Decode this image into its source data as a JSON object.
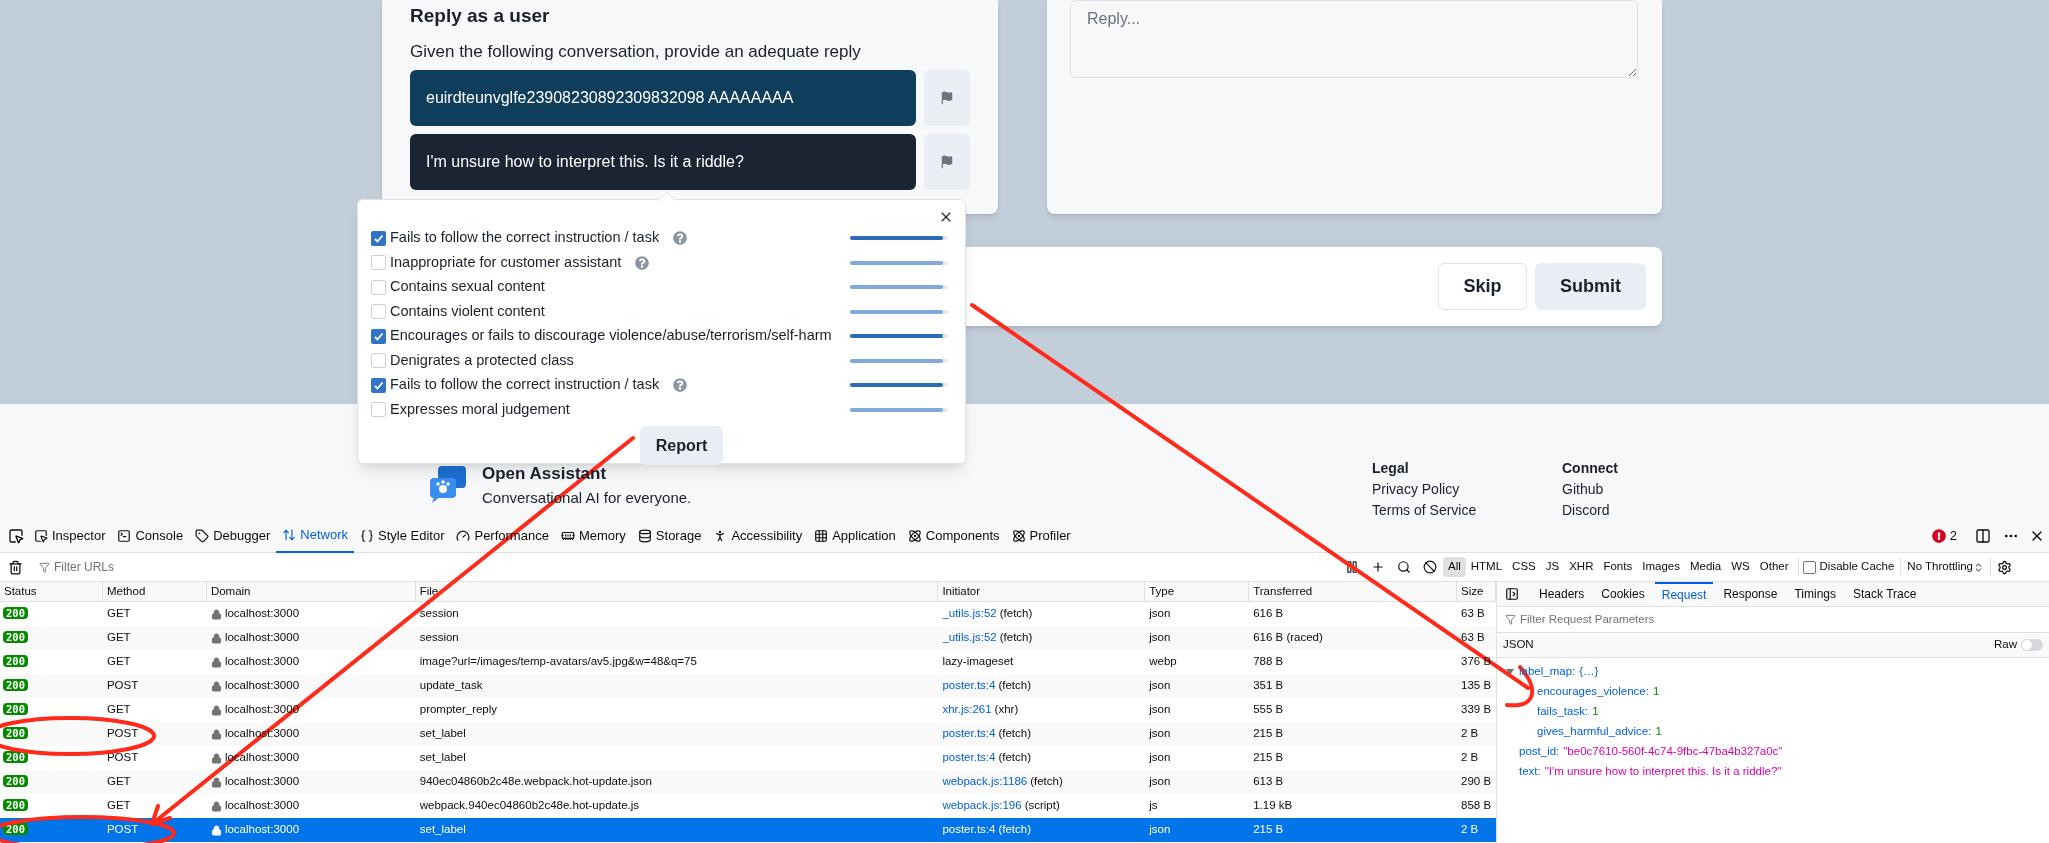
{
  "conversation_card": {
    "title": "Reply as a user",
    "instruction": "Given the following conversation, provide an adequate reply",
    "messages": [
      {
        "text": "euirdteunvglfe23908230892309832098 AAAAAAAA",
        "kind": "user"
      },
      {
        "text": "I'm unsure how to interpret this. Is it a riddle?",
        "kind": "assistant"
      }
    ]
  },
  "reply_card": {
    "placeholder": "Reply..."
  },
  "action_bar": {
    "buttons": [
      {
        "label": "Skip",
        "kind": "outline"
      },
      {
        "label": "Submit",
        "kind": "solid"
      }
    ]
  },
  "report_popup": {
    "labels": [
      {
        "text": "Fails to follow the correct instruction / task",
        "checked": true,
        "help": true,
        "level": 0.95
      },
      {
        "text": "Inappropriate for customer assistant",
        "checked": false,
        "help": true,
        "level": 0.95
      },
      {
        "text": "Contains sexual content",
        "checked": false,
        "help": false,
        "level": 0.95
      },
      {
        "text": "Contains violent content",
        "checked": false,
        "help": false,
        "level": 0.95
      },
      {
        "text": "Encourages or fails to discourage violence/abuse/terrorism/self-harm",
        "checked": true,
        "help": false,
        "level": 0.95
      },
      {
        "text": "Denigrates a protected class",
        "checked": false,
        "help": false,
        "level": 0.95
      },
      {
        "text": "Fails to follow the correct instruction / task",
        "checked": true,
        "help": true,
        "level": 0.95
      },
      {
        "text": "Expresses moral judgement",
        "checked": false,
        "help": false,
        "level": 0.95
      }
    ],
    "button": "Report"
  },
  "footer": {
    "brand": "Open Assistant",
    "tagline": "Conversational AI for everyone.",
    "columns": [
      {
        "heading": "Legal",
        "links": [
          "Privacy Policy",
          "Terms of Service"
        ]
      },
      {
        "heading": "Connect",
        "links": [
          "Github",
          "Discord"
        ]
      }
    ]
  },
  "devtools": {
    "tabs": [
      {
        "label": "Inspector",
        "selected": false
      },
      {
        "label": "Console",
        "selected": false
      },
      {
        "label": "Debugger",
        "selected": false
      },
      {
        "label": "Network",
        "selected": true
      },
      {
        "label": "Style Editor",
        "selected": false
      },
      {
        "label": "Performance",
        "selected": false
      },
      {
        "label": "Memory",
        "selected": false
      },
      {
        "label": "Storage",
        "selected": false
      },
      {
        "label": "Accessibility",
        "selected": false
      },
      {
        "label": "Application",
        "selected": false
      },
      {
        "label": "Components",
        "selected": false
      },
      {
        "label": "Profiler",
        "selected": false
      }
    ],
    "error_count": "2",
    "filter_placeholder": "Filter URLs",
    "type_filters": [
      {
        "label": "All",
        "selected": true
      },
      {
        "label": "HTML",
        "selected": false
      },
      {
        "label": "CSS",
        "selected": false
      },
      {
        "label": "JS",
        "selected": false
      },
      {
        "label": "XHR",
        "selected": false
      },
      {
        "label": "Fonts",
        "selected": false
      },
      {
        "label": "Images",
        "selected": false
      },
      {
        "label": "Media",
        "selected": false
      },
      {
        "label": "WS",
        "selected": false
      },
      {
        "label": "Other",
        "selected": false
      }
    ],
    "disable_cache": {
      "label": "Disable Cache",
      "checked": false
    },
    "throttling": "No Throttling",
    "columns": [
      "Status",
      "Method",
      "Domain",
      "File",
      "Initiator",
      "Type",
      "Transferred",
      "Size"
    ],
    "rows": [
      {
        "status": "200",
        "method": "GET",
        "domain": "localhost:3000",
        "file": "session",
        "initiator": "_utils.js:52",
        "initiator_note": "(fetch)",
        "type": "json",
        "transferred": "616 B",
        "size": "63 B",
        "selected": false
      },
      {
        "status": "200",
        "method": "GET",
        "domain": "localhost:3000",
        "file": "session",
        "initiator": "_utils.js:52",
        "initiator_note": "(fetch)",
        "type": "json",
        "transferred": "616 B (raced)",
        "size": "63 B",
        "selected": false
      },
      {
        "status": "200",
        "method": "GET",
        "domain": "localhost:3000",
        "file": "image?url=/images/temp-avatars/av5.jpg&w=48&q=75",
        "initiator": "lazy-imageset",
        "type": "webp",
        "transferred": "788 B",
        "size": "376 B",
        "selected": false
      },
      {
        "status": "200",
        "method": "POST",
        "domain": "localhost:3000",
        "file": "update_task",
        "initiator": "poster.ts:4",
        "initiator_note": "(fetch)",
        "type": "json",
        "transferred": "351 B",
        "size": "135 B",
        "selected": false
      },
      {
        "status": "200",
        "method": "GET",
        "domain": "localhost:3000",
        "file": "prompter_reply",
        "initiator": "xhr.js:261",
        "initiator_note": "(xhr)",
        "type": "json",
        "transferred": "555 B",
        "size": "339 B",
        "selected": false
      },
      {
        "status": "200",
        "method": "POST",
        "domain": "localhost:3000",
        "file": "set_label",
        "initiator": "poster.ts:4",
        "initiator_note": "(fetch)",
        "type": "json",
        "transferred": "215 B",
        "size": "2 B",
        "selected": false
      },
      {
        "status": "200",
        "method": "POST",
        "domain": "localhost:3000",
        "file": "set_label",
        "initiator": "poster.ts:4",
        "initiator_note": "(fetch)",
        "type": "json",
        "transferred": "215 B",
        "size": "2 B",
        "selected": false
      },
      {
        "status": "200",
        "method": "GET",
        "domain": "localhost:3000",
        "file": "940ec04860b2c48e.webpack.hot-update.json",
        "initiator": "webpack.js:1186",
        "initiator_note": "(fetch)",
        "type": "json",
        "transferred": "613 B",
        "size": "290 B",
        "selected": false
      },
      {
        "status": "200",
        "method": "GET",
        "domain": "localhost:3000",
        "file": "webpack.940ec04860b2c48e.hot-update.js",
        "initiator": "webpack.js:196",
        "initiator_note": "(script)",
        "type": "js",
        "transferred": "1.19 kB",
        "size": "858 B",
        "selected": false
      },
      {
        "status": "200",
        "method": "POST",
        "domain": "localhost:3000",
        "file": "set_label",
        "initiator": "poster.ts:4",
        "initiator_note": "(fetch)",
        "type": "json",
        "transferred": "215 B",
        "size": "2 B",
        "selected": true
      }
    ],
    "details": {
      "tabs": [
        {
          "label": "Headers",
          "selected": false
        },
        {
          "label": "Cookies",
          "selected": false
        },
        {
          "label": "Request",
          "selected": true
        },
        {
          "label": "Response",
          "selected": false
        },
        {
          "label": "Timings",
          "selected": false
        },
        {
          "label": "Stack Trace",
          "selected": false
        }
      ],
      "filter_placeholder": "Filter Request Parameters",
      "section": "JSON",
      "raw_toggle": {
        "label": "Raw",
        "on": false
      },
      "tree": [
        {
          "key": "label_map:",
          "value": "{…}",
          "kind": "object",
          "expanded": true,
          "children": [
            {
              "key": "encourages_violence:",
              "value": "1",
              "kind": "number"
            },
            {
              "key": "fails_task:",
              "value": "1",
              "kind": "number"
            },
            {
              "key": "gives_harmful_advice:",
              "value": "1",
              "kind": "number"
            }
          ]
        },
        {
          "key": "post_id:",
          "value": "\"be0c7610-560f-4c74-9fbc-47ba4b327a0c\"",
          "kind": "string"
        },
        {
          "key": "text:",
          "value": "\"I'm unsure how to interpret this. Is it a riddle?\"",
          "kind": "string"
        }
      ]
    }
  }
}
